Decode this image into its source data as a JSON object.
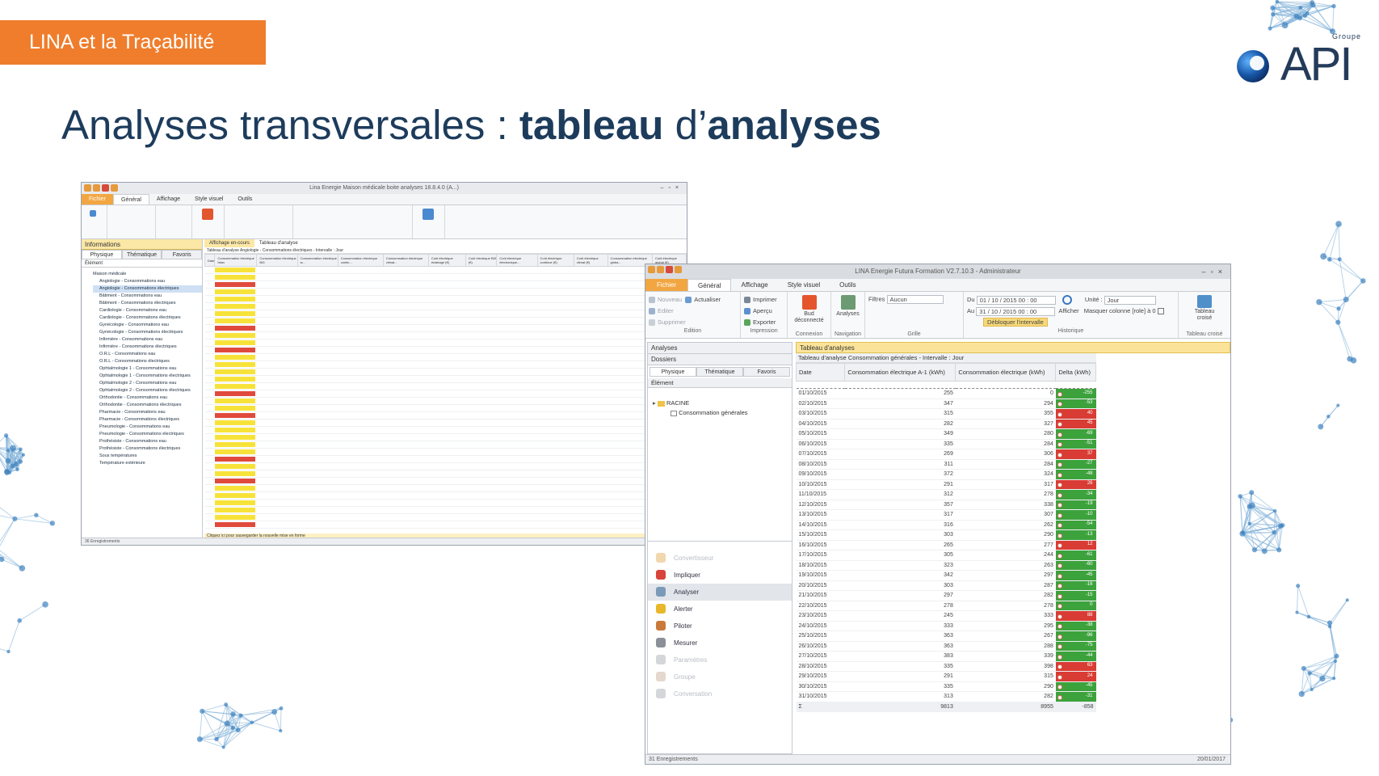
{
  "slide": {
    "tag": "LINA et la Traçabilité",
    "title_plain1": "Analyses transversales : ",
    "title_bold1": "tableau",
    "title_plain2": " d’",
    "title_bold2": "analyses",
    "logo_group": "Groupe",
    "logo_text": "API",
    "accent_color": "#ef7d2c",
    "title_color": "#1d3c5c"
  },
  "back_window": {
    "title": "Lina Energie Maison médicale boite analyses 18.8.4.0 (A...)",
    "menu": [
      "Fichier",
      "Général",
      "Affichage",
      "Style visuel",
      "Outils"
    ],
    "panel_header": "Informations",
    "tabs": [
      "Physique",
      "Thématique",
      "Favoris"
    ],
    "element_label": "Élément",
    "tree": [
      "Maison médicale",
      "Angiologie - Consommations eau",
      "Angiologie - Consommations électriques",
      "Bâtiment - Consommations eau",
      "Bâtiment - Consommations électriques",
      "Cardiologie - Consommations eau",
      "Cardiologie - Consommations électriques",
      "Gynécologie - Consommations eau",
      "Gynécologie - Consommations électriques",
      "Infirmière - Consommations eau",
      "Infirmière - Consommations électriques",
      "O.R.L - Consommations eau",
      "O.R.L - Consommations électriques",
      "Ophtalmologie 1 - Consommations eau",
      "Ophtalmologie 1 - Consommations électriques",
      "Ophtalmologie 2 - Consommations eau",
      "Ophtalmologie 2 - Consommations électriques",
      "Orthodontie - Consommations eau",
      "Orthodontie - Consommations électriques",
      "Pharmacie - Consommations eau",
      "Pharmacie - Consommations électriques",
      "Pneumologie - Consommations eau",
      "Pneumologie - Consommations électriques",
      "Prothésiste - Consommations eau",
      "Prothésiste - Consommations électriques",
      "Sous températures",
      "Température extérieure"
    ],
    "grid_tabs": [
      "Affichage en-cours",
      "Tableau d'analyse"
    ],
    "grid_caption": "Tableau d'analyse Angiologie - Consommations électriques - Intervalle : Jour",
    "columns": [
      "Date",
      "Consommation électrique bilan",
      "Consommation électrique Bt3",
      "Consommation électrique w...",
      "Consommation électrique contin...",
      "Consommation électrique climat...",
      "Coût électrique éclairage (€)",
      "Coût électrique Bt3 (€)",
      "Coût électrique électronique...",
      "Coût électrique continue (€)",
      "Coût électrique climat (€)",
      "Consommation électrique globa...",
      "Coût électrique global (€)"
    ],
    "rows": 36,
    "footer_hint": "Cliquez ici pour sauvegarder la nouvelle mise en forme",
    "status": "36 Enregistrements"
  },
  "front_window": {
    "title": "LINA Energie Futura Formation V2.7.10.3 - Administrateur",
    "menu": [
      "Fichier",
      "Général",
      "Affichage",
      "Style visuel",
      "Outils"
    ],
    "ribbon": {
      "edition": [
        "Nouveau",
        "Editer",
        "Supprimer"
      ],
      "actualiser": "Actualiser",
      "impression": [
        "Imprimer",
        "Aperçu",
        "Exporter"
      ],
      "bud": "Bud déconnecté",
      "analyses": "Analyses",
      "filters_label": "Filtres",
      "filters_value": "Aucun",
      "du_label": "Du",
      "du_value": "01 / 10 / 2015   00 : 00",
      "au_label": "Au",
      "au_value": "31 / 10 / 2015   00 : 00",
      "debloquer": "Débloquer l'intervalle",
      "afficher": "Afficher",
      "unit_label": "Unité :",
      "unit_value": "Jour",
      "masquer": "Masquer colonne [role] à 0",
      "tableau_croise": "Tableau croisé",
      "groups": [
        "Edition",
        "Impression",
        "Connexion",
        "Navigation",
        "Grille",
        "Historique",
        "Tableau croisé"
      ]
    },
    "panel_header": "Analyses",
    "dossiers": "Dossiers",
    "tabs": [
      "Physique",
      "Thématique",
      "Favoris"
    ],
    "element_label": "Élément",
    "tree_root": "RACINE",
    "tree_child": "Consommation générales",
    "nav": [
      {
        "label": "Convertisseur",
        "enabled": false,
        "color": "#e0a64a"
      },
      {
        "label": "Impliquer",
        "enabled": true,
        "color": "#d8443a"
      },
      {
        "label": "Analyser",
        "enabled": true,
        "color": "#7a9ab8"
      },
      {
        "label": "Alerter",
        "enabled": true,
        "color": "#e8b82a"
      },
      {
        "label": "Piloter",
        "enabled": true,
        "color": "#c97a3a"
      },
      {
        "label": "Mesurer",
        "enabled": true,
        "color": "#8a8f98"
      },
      {
        "label": "Paramètres",
        "enabled": false,
        "color": "#a0a4ac"
      },
      {
        "label": "Groupe",
        "enabled": false,
        "color": "#c3a894"
      },
      {
        "label": "Conversation",
        "enabled": false,
        "color": "#a0a4ac"
      }
    ],
    "grid_header": "Tableau d'analyses",
    "grid_caption": "Tableau d'analyse Consommation générales - Intervalle : Jour",
    "columns": [
      "Date",
      "Consommation électrique A-1 (kWh)",
      "Consommation électrique (kWh)",
      "Delta (kWh)"
    ],
    "rows": [
      {
        "date": "01/10/2015",
        "a1": "255",
        "cur": "0",
        "delta": "-255"
      },
      {
        "date": "02/10/2015",
        "a1": "347",
        "cur": "294",
        "delta": "-53"
      },
      {
        "date": "03/10/2015",
        "a1": "315",
        "cur": "355",
        "delta": "40"
      },
      {
        "date": "04/10/2015",
        "a1": "282",
        "cur": "327",
        "delta": "45"
      },
      {
        "date": "05/10/2015",
        "a1": "349",
        "cur": "280",
        "delta": "-69"
      },
      {
        "date": "06/10/2015",
        "a1": "335",
        "cur": "284",
        "delta": "-51"
      },
      {
        "date": "07/10/2015",
        "a1": "269",
        "cur": "306",
        "delta": "37"
      },
      {
        "date": "08/10/2015",
        "a1": "311",
        "cur": "284",
        "delta": "-27"
      },
      {
        "date": "09/10/2015",
        "a1": "372",
        "cur": "324",
        "delta": "-48"
      },
      {
        "date": "10/10/2015",
        "a1": "291",
        "cur": "317",
        "delta": "26"
      },
      {
        "date": "11/10/2015",
        "a1": "312",
        "cur": "278",
        "delta": "-34"
      },
      {
        "date": "12/10/2015",
        "a1": "357",
        "cur": "338",
        "delta": "-19"
      },
      {
        "date": "13/10/2015",
        "a1": "317",
        "cur": "307",
        "delta": "-10"
      },
      {
        "date": "14/10/2015",
        "a1": "316",
        "cur": "262",
        "delta": "-54"
      },
      {
        "date": "15/10/2015",
        "a1": "303",
        "cur": "290",
        "delta": "-13"
      },
      {
        "date": "16/10/2015",
        "a1": "265",
        "cur": "277",
        "delta": "12"
      },
      {
        "date": "17/10/2015",
        "a1": "305",
        "cur": "244",
        "delta": "-61"
      },
      {
        "date": "18/10/2015",
        "a1": "323",
        "cur": "263",
        "delta": "-60"
      },
      {
        "date": "19/10/2015",
        "a1": "342",
        "cur": "297",
        "delta": "-45"
      },
      {
        "date": "20/10/2015",
        "a1": "303",
        "cur": "287",
        "delta": "-16"
      },
      {
        "date": "21/10/2015",
        "a1": "297",
        "cur": "282",
        "delta": "-15"
      },
      {
        "date": "22/10/2015",
        "a1": "278",
        "cur": "278",
        "delta": "0"
      },
      {
        "date": "23/10/2015",
        "a1": "245",
        "cur": "333",
        "delta": "88"
      },
      {
        "date": "24/10/2015",
        "a1": "333",
        "cur": "295",
        "delta": "-38"
      },
      {
        "date": "25/10/2015",
        "a1": "363",
        "cur": "267",
        "delta": "-96"
      },
      {
        "date": "26/10/2015",
        "a1": "363",
        "cur": "288",
        "delta": "-75"
      },
      {
        "date": "27/10/2015",
        "a1": "383",
        "cur": "339",
        "delta": "-44"
      },
      {
        "date": "28/10/2015",
        "a1": "335",
        "cur": "398",
        "delta": "63"
      },
      {
        "date": "29/10/2015",
        "a1": "291",
        "cur": "315",
        "delta": "24"
      },
      {
        "date": "30/10/2015",
        "a1": "335",
        "cur": "290",
        "delta": "-45"
      },
      {
        "date": "31/10/2015",
        "a1": "313",
        "cur": "282",
        "delta": "-31"
      }
    ],
    "totals": {
      "a1": "9813",
      "cur": "8955",
      "delta": "-858"
    },
    "status_left": "31 Enregistrements",
    "status_right": "20/01/2017",
    "pos_color": "#d83c34",
    "neg_color": "#3ca23c"
  }
}
